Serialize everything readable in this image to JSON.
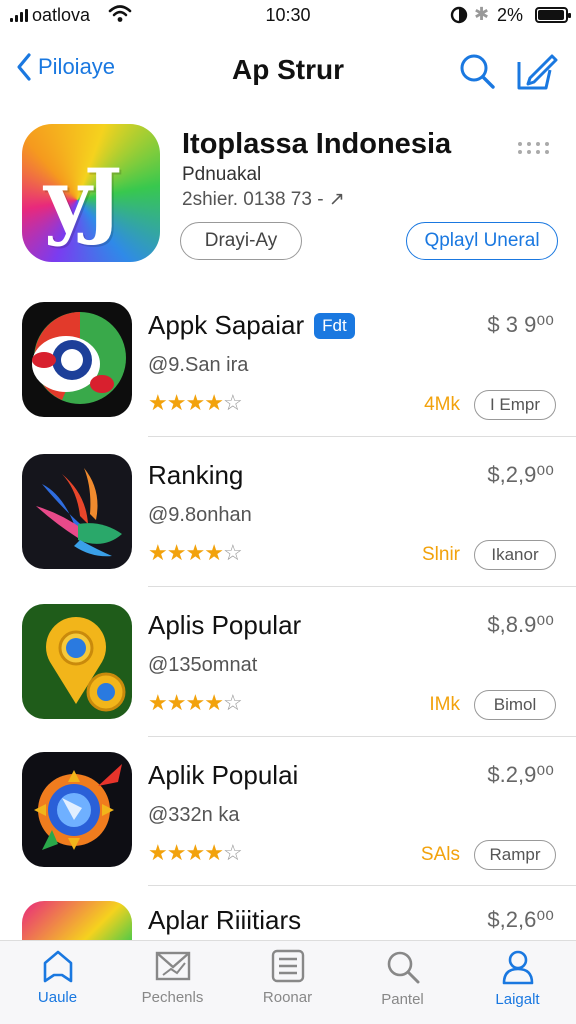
{
  "status_bar": {
    "carrier": "oatlova",
    "time": "10:30",
    "battery_pct": "2%",
    "battery_level": 0.9
  },
  "nav": {
    "back_label": "Piloiaye",
    "title": "Ap Strur"
  },
  "featured": {
    "glyph": "yJ",
    "title": "Itoplassa Indonesia",
    "subtitle": "Pdnuakal",
    "meta": "2shier. 0138 73 - ↗",
    "button_primary": "Drayi-Ay",
    "button_secondary": "Qplayl Uneral"
  },
  "apps": [
    {
      "name": "Appk Sapaiar",
      "badge": "Fdt",
      "subtitle": "@9.San ira",
      "stars": 4,
      "price": "$ 3 9⁰⁰",
      "size": "4Mk",
      "get_label": "I Empr",
      "icon": "chrome-style-icon"
    },
    {
      "name": "Ranking",
      "badge": "",
      "subtitle": "@9.8onhan",
      "stars": 4,
      "price": "$,2,9⁰⁰",
      "size": "Slnir",
      "get_label": "Ikanor",
      "icon": "bird-icon"
    },
    {
      "name": "Aplis Popular",
      "badge": "",
      "subtitle": "@135omnat",
      "stars": 4,
      "price": "$,8.9⁰⁰",
      "size": "IMk",
      "get_label": "Bimol",
      "icon": "location-pin-icon"
    },
    {
      "name": "Aplik Populai",
      "badge": "",
      "subtitle": "@332n ka",
      "stars": 4,
      "price": "$.2,9⁰⁰",
      "size": "SAls",
      "get_label": "Rampr",
      "icon": "compass-rocket-icon"
    },
    {
      "name": "Aplar Riiitiars",
      "badge": "",
      "subtitle": "",
      "stars": 0,
      "price": "$,2,6⁰⁰",
      "size": "",
      "get_label": "",
      "icon": "gradient-app-icon"
    }
  ],
  "tabs": [
    {
      "label": "Uaule",
      "icon": "home-icon",
      "active": true
    },
    {
      "label": "Pechenls",
      "icon": "mail-chart-icon",
      "active": false
    },
    {
      "label": "Roonar",
      "icon": "list-icon",
      "active": false
    },
    {
      "label": "Pantel",
      "icon": "search-icon",
      "active": false
    },
    {
      "label": "Laigalt",
      "icon": "person-icon",
      "active": false
    }
  ],
  "colors": {
    "accent": "#1a78e0",
    "star": "#f2a20c"
  }
}
